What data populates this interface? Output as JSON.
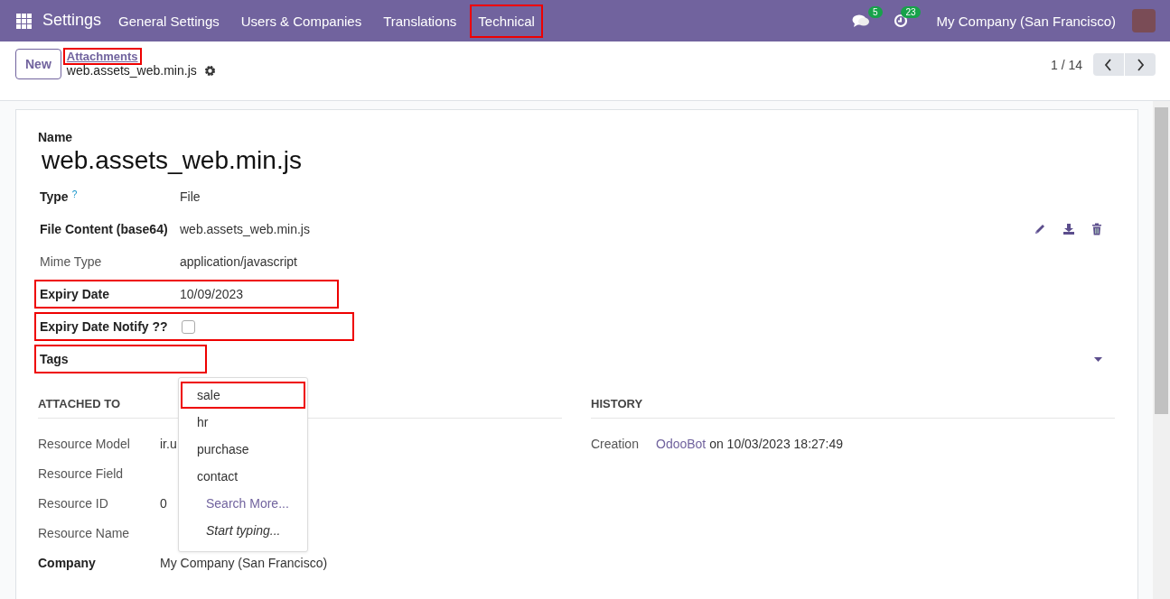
{
  "navbar": {
    "app": "Settings",
    "menu": [
      {
        "label": "General Settings",
        "highlighted": false
      },
      {
        "label": "Users & Companies",
        "highlighted": false
      },
      {
        "label": "Translations",
        "highlighted": false
      },
      {
        "label": "Technical",
        "highlighted": true
      }
    ],
    "messages_count": "5",
    "activities_count": "23",
    "company": "My Company (San Francisco)"
  },
  "control_panel": {
    "new_button": "New",
    "breadcrumb": {
      "label": "Attachments",
      "highlighted": true
    },
    "record_name": "web.assets_web.min.js",
    "pager": "1 / 14"
  },
  "form": {
    "name_label": "Name",
    "name": "web.assets_web.min.js",
    "fields": [
      {
        "kind": "text",
        "label": "Type",
        "help": "?",
        "value": "File",
        "bold": true,
        "highlighted": false
      },
      {
        "kind": "file",
        "label": "File Content (base64)",
        "value": "web.assets_web.min.js",
        "bold": true,
        "highlighted": false
      },
      {
        "kind": "text",
        "label": "Mime Type",
        "value": "application/javascript",
        "bold": false,
        "highlighted": false
      },
      {
        "kind": "text",
        "label": "Expiry Date",
        "value": "10/09/2023",
        "bold": true,
        "highlighted": true
      },
      {
        "kind": "checkbox",
        "label": "Expiry Date Notify ??",
        "checked": false,
        "bold": true,
        "highlighted": true
      },
      {
        "kind": "tags",
        "label": "Tags",
        "bold": true,
        "highlighted": true,
        "dropdown": [
          {
            "kind": "option",
            "label": "sale",
            "highlighted": true
          },
          {
            "kind": "option",
            "label": "hr",
            "highlighted": false
          },
          {
            "kind": "option",
            "label": "purchase",
            "highlighted": false
          },
          {
            "kind": "option",
            "label": "contact",
            "highlighted": false
          },
          {
            "kind": "search_more",
            "label": "Search More...",
            "highlighted": false
          },
          {
            "kind": "hint",
            "label": "Start typing...",
            "highlighted": false
          }
        ]
      }
    ],
    "attached_to": {
      "title": "ATTACHED TO",
      "fields": [
        {
          "label": "Resource Model",
          "value": "ir.u",
          "bold": false
        },
        {
          "label": "Resource Field",
          "bold": false
        },
        {
          "label": "Resource ID",
          "value": "0",
          "bold": false
        },
        {
          "label": "Resource Name",
          "bold": false
        },
        {
          "label": "Company",
          "value": "My Company (San Francisco)",
          "bold": true
        }
      ]
    },
    "history": {
      "title": "HISTORY",
      "fields": [
        {
          "label": "Creation",
          "author": "OdooBot",
          "text": "on 10/03/2023 18:27:49"
        }
      ]
    }
  }
}
